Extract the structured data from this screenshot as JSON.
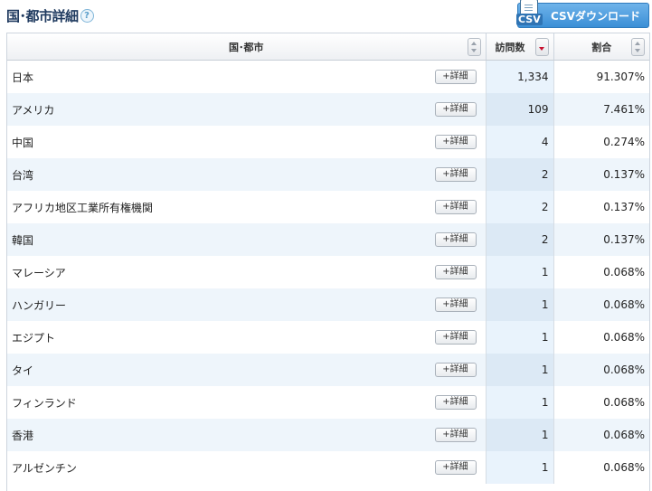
{
  "header": {
    "title": "国･都市詳細",
    "help_icon": "?",
    "csv_icon_label": "CSV",
    "csv_button_label": "CSVダウンロード"
  },
  "table": {
    "columns": [
      "国･都市",
      "訪問数",
      "割合"
    ],
    "detail_label": "+詳細",
    "rows": [
      {
        "name": "日本",
        "visits": "1,334",
        "ratio": "91.307%"
      },
      {
        "name": "アメリカ",
        "visits": "109",
        "ratio": "7.461%"
      },
      {
        "name": "中国",
        "visits": "4",
        "ratio": "0.274%"
      },
      {
        "name": "台湾",
        "visits": "2",
        "ratio": "0.137%"
      },
      {
        "name": "アフリカ地区工業所有権機関",
        "visits": "2",
        "ratio": "0.137%"
      },
      {
        "name": "韓国",
        "visits": "2",
        "ratio": "0.137%"
      },
      {
        "name": "マレーシア",
        "visits": "1",
        "ratio": "0.068%"
      },
      {
        "name": "ハンガリー",
        "visits": "1",
        "ratio": "0.068%"
      },
      {
        "name": "エジプト",
        "visits": "1",
        "ratio": "0.068%"
      },
      {
        "name": "タイ",
        "visits": "1",
        "ratio": "0.068%"
      },
      {
        "name": "フィンランド",
        "visits": "1",
        "ratio": "0.068%"
      },
      {
        "name": "香港",
        "visits": "1",
        "ratio": "0.068%"
      },
      {
        "name": "アルゼンチン",
        "visits": "1",
        "ratio": "0.068%"
      }
    ]
  }
}
